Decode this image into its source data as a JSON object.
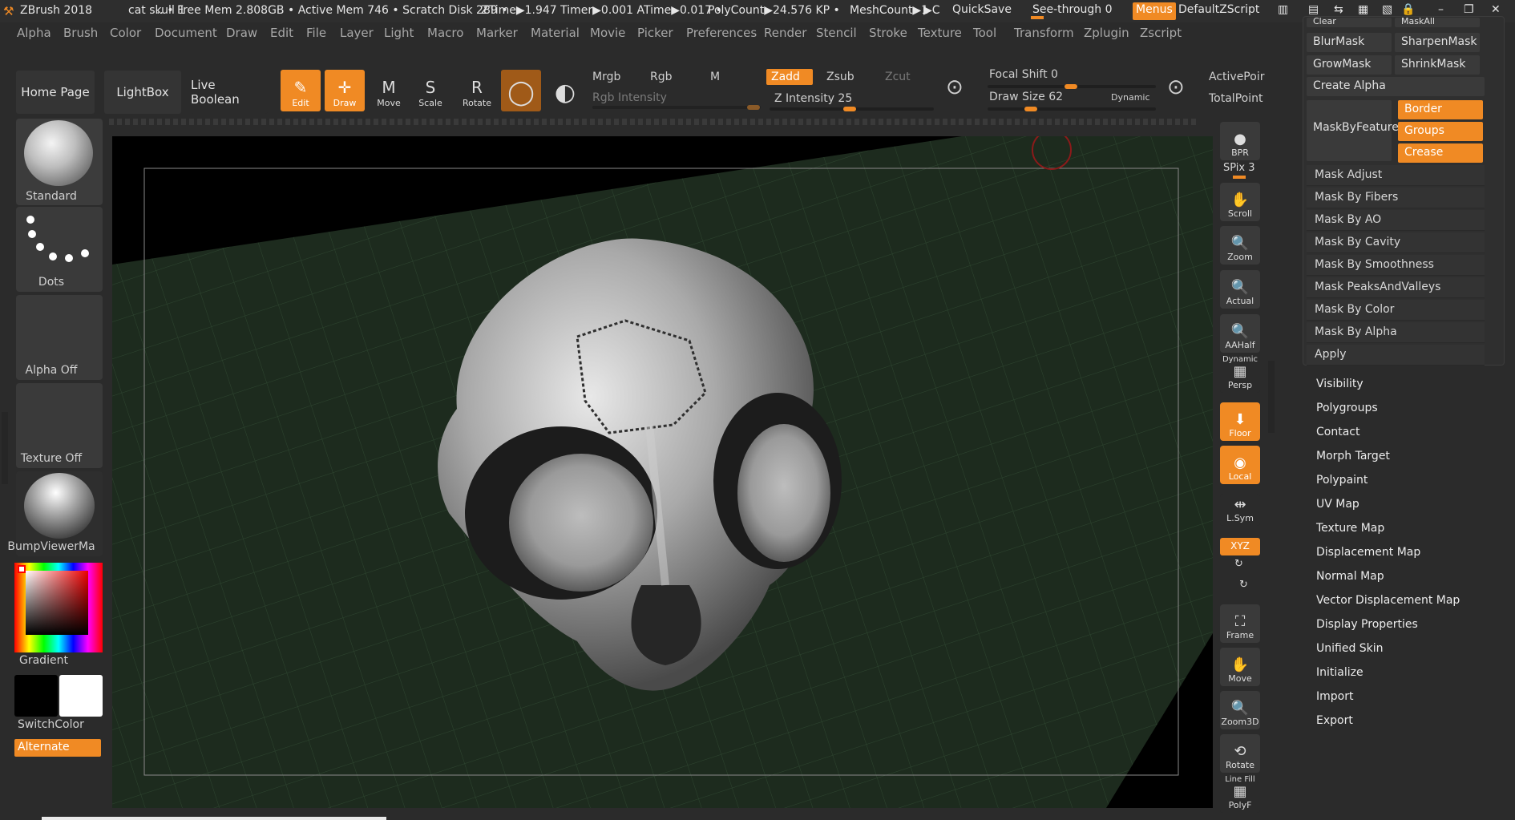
{
  "titlebar": {
    "app": "ZBrush 2018",
    "document": "cat skull 1",
    "stats": ".. • Free Mem 2.808GB • Active Mem 746 • Scratch Disk 289 •",
    "ztime": "ZTime▶1.947 Timer▶0.001 ATime▶0.017 •",
    "polycount": "PolyCount▶24.576 KP •",
    "meshcount": "MeshCount▶1",
    "quicksave": "QuickSave",
    "seethrough": "See-through  0",
    "menus": "Menus",
    "script": "DefaultZScript"
  },
  "menubar": [
    "Alpha",
    "Brush",
    "Color",
    "Document",
    "Draw",
    "Edit",
    "File",
    "Layer",
    "Light",
    "Macro",
    "Marker",
    "Material",
    "Movie",
    "Picker",
    "Preferences",
    "Render",
    "Stencil",
    "Stroke",
    "Texture",
    "Tool",
    "Transform",
    "Zplugin",
    "Zscript"
  ],
  "toolbar": {
    "home": "Home Page",
    "lightbox": "LightBox",
    "liveboolean": "Live Boolean",
    "edit": "Edit",
    "draw": "Draw",
    "move": "Move",
    "scale": "Scale",
    "rotate": "Rotate",
    "mrgb": "Mrgb",
    "rgb": "Rgb",
    "m": "M",
    "rgb_intensity": "Rgb Intensity",
    "zadd": "Zadd",
    "zsub": "Zsub",
    "zcut": "Zcut",
    "z_intensity": "Z Intensity 25",
    "focal_shift": "Focal Shift 0",
    "draw_size": "Draw Size 62",
    "dynamic": "Dynamic",
    "activepoints": "ActivePoir",
    "totalpoints": "TotalPoint"
  },
  "left": {
    "brush": "Standard",
    "stroke": "Dots",
    "alpha": "Alpha Off",
    "texture": "Texture Off",
    "material": "BumpViewerMa",
    "gradient": "Gradient",
    "switchcolor": "SwitchColor",
    "alternate": "Alternate"
  },
  "shelf": {
    "bpr": "BPR",
    "spix": "SPix 3",
    "scroll": "Scroll",
    "zoom": "Zoom",
    "actual": "Actual",
    "aahalf": "AAHalf",
    "dynamic": "Dynamic",
    "persp": "Persp",
    "floor": "Floor",
    "local": "Local",
    "lsym": "L.Sym",
    "xyz": "XYZ",
    "frame": "Frame",
    "move": "Move",
    "zoom3d": "Zoom3D",
    "rotate": "Rotate",
    "linefill": "Line Fill",
    "polyf": "PolyF"
  },
  "palette": {
    "top_left": "Clear",
    "top_right": "MaskAll",
    "blurmask": "BlurMask",
    "sharpenmask": "SharpenMask",
    "growmask": "GrowMask",
    "shrinkmask": "ShrinkMask",
    "createalpha": "Create Alpha",
    "maskbyfeature": "MaskByFeature",
    "border": "Border",
    "groups": "Groups",
    "crease": "Crease",
    "mask_items": [
      "Mask Adjust",
      "Mask By Fibers",
      "Mask By AO",
      "Mask By Cavity",
      "Mask By Smoothness",
      "Mask PeaksAndValleys",
      "Mask By Color",
      "Mask By Alpha",
      "Apply"
    ],
    "sections": [
      "Visibility",
      "Polygroups",
      "Contact",
      "Morph Target",
      "Polypaint",
      "UV Map",
      "Texture Map",
      "Displacement Map",
      "Normal Map",
      "Vector Displacement Map",
      "Display Properties",
      "Unified Skin",
      "Initialize",
      "Import",
      "Export"
    ]
  },
  "colors": {
    "accent": "#f08a24",
    "bg": "#2b2b2b",
    "button": "#3a3a3a"
  }
}
